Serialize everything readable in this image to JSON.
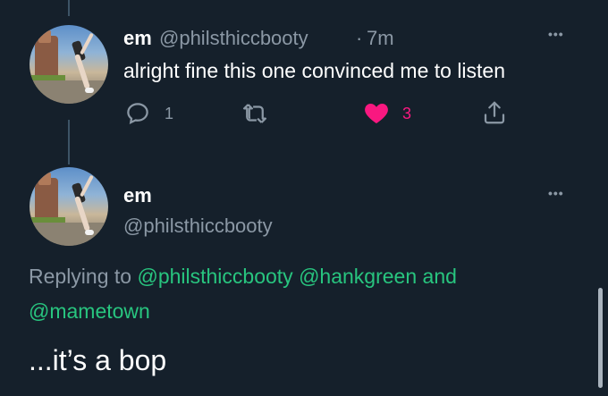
{
  "tweet1": {
    "display_name": "em",
    "handle": "@philsthiccbooty",
    "separator": "·",
    "time": "7m",
    "text": "alright fine this one convinced me to listen",
    "more_label": "•••",
    "reply_count": "1",
    "like_count": "3",
    "colors": {
      "like": "#f91880",
      "icon": "#8b98a5"
    }
  },
  "tweet2": {
    "display_name": "em",
    "handle": "@philsthiccbooty",
    "more_label": "•••",
    "replying_prefix": "Replying to",
    "mention1": "@philsthiccbooty",
    "mention2": "@hankgreen",
    "and_word": "and",
    "mention3": "@mametown",
    "text": "...it’s a bop",
    "colors": {
      "mention": "#28c57f"
    }
  },
  "theme": {
    "background": "#15202b",
    "text": "#ffffff",
    "muted": "#8b98a5"
  }
}
